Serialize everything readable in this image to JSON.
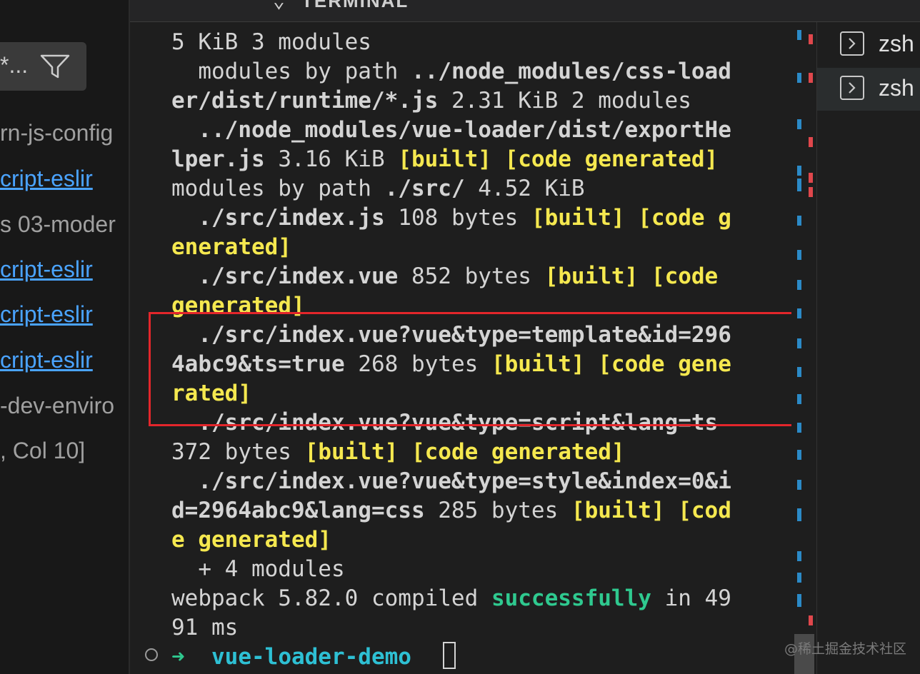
{
  "sidebar": {
    "filter_placeholder": "*...",
    "rows": [
      {
        "text": "rn-js-config",
        "link": false
      },
      {
        "text": "cript-eslir",
        "link": true
      },
      {
        "text": "s  03-moder",
        "link": false
      },
      {
        "text": "cript-eslir",
        "link": true
      },
      {
        "text": "cript-eslir",
        "link": true
      },
      {
        "text": "cript-eslir",
        "link": true
      },
      {
        "text": "-dev-enviro",
        "link": false
      },
      {
        "text": ", Col 10]",
        "link": false
      }
    ]
  },
  "terminal": {
    "header_title": "TERMINAL",
    "lines": [
      [
        {
          "t": "5 KiB 3 modules",
          "c": ""
        }
      ],
      [
        {
          "t": "  modules by path ",
          "c": ""
        },
        {
          "t": "../node_modules/css-load",
          "c": "b"
        }
      ],
      [
        {
          "t": "er/dist/runtime/*.js",
          "c": "b"
        },
        {
          "t": " 2.31 KiB 2 modules",
          "c": ""
        }
      ],
      [
        {
          "t": "  ../node_modules/vue-loader/dist/exportHe",
          "c": "b"
        }
      ],
      [
        {
          "t": "lper.js",
          "c": "b"
        },
        {
          "t": " 3.16 KiB ",
          "c": ""
        },
        {
          "t": "[built] [code generated]",
          "c": "y"
        }
      ],
      [
        {
          "t": "modules by path ",
          "c": ""
        },
        {
          "t": "./src/",
          "c": "b"
        },
        {
          "t": " 4.52 KiB",
          "c": ""
        }
      ],
      [
        {
          "t": "  ./src/index.js",
          "c": "b"
        },
        {
          "t": " 108 bytes ",
          "c": ""
        },
        {
          "t": "[built] [code g",
          "c": "y"
        }
      ],
      [
        {
          "t": "enerated]",
          "c": "y"
        }
      ],
      [
        {
          "t": "  ./src/index.vue",
          "c": "b"
        },
        {
          "t": " 852 bytes ",
          "c": ""
        },
        {
          "t": "[built] [code",
          "c": "y"
        }
      ],
      [
        {
          "t": "generated]",
          "c": "y"
        }
      ],
      [
        {
          "t": "  ./src/index.vue?vue&type=template&id=296",
          "c": "b"
        }
      ],
      [
        {
          "t": "4abc9&ts=true",
          "c": "b"
        },
        {
          "t": " 268 bytes ",
          "c": ""
        },
        {
          "t": "[built] [code gene",
          "c": "y"
        }
      ],
      [
        {
          "t": "rated]",
          "c": "y"
        }
      ],
      [
        {
          "t": "  ./src/index.vue?vue&type=script&lang=ts",
          "c": "b"
        }
      ],
      [
        {
          "t": "372 bytes ",
          "c": ""
        },
        {
          "t": "[built] [code generated]",
          "c": "y"
        }
      ],
      [
        {
          "t": "  ./src/index.vue?vue&type=style&index=0&i",
          "c": "b"
        }
      ],
      [
        {
          "t": "d=2964abc9&lang=css",
          "c": "b"
        },
        {
          "t": " 285 bytes ",
          "c": ""
        },
        {
          "t": "[built] [cod",
          "c": "y"
        }
      ],
      [
        {
          "t": "e generated]",
          "c": "y"
        }
      ],
      [
        {
          "t": "  + 4 modules",
          "c": ""
        }
      ],
      [
        {
          "t": "webpack 5.82.0 compiled ",
          "c": ""
        },
        {
          "t": "successfully",
          "c": "g"
        },
        {
          "t": " in 49",
          "c": ""
        }
      ],
      [
        {
          "t": "91 ms",
          "c": ""
        }
      ]
    ],
    "prompt_arrow": "➜",
    "prompt_dir": "vue-loader-demo"
  },
  "tabs": [
    {
      "label": "zsh",
      "active": false
    },
    {
      "label": "zsh",
      "active": true
    }
  ],
  "watermark": "@稀土掘金技术社区",
  "colors": {
    "highlight_box": "#e3262b",
    "yellow_text": "#f5e84f",
    "success_green": "#2fc98f",
    "prompt_cyan": "#2ec0d4",
    "link_blue": "#4aa3ff"
  }
}
